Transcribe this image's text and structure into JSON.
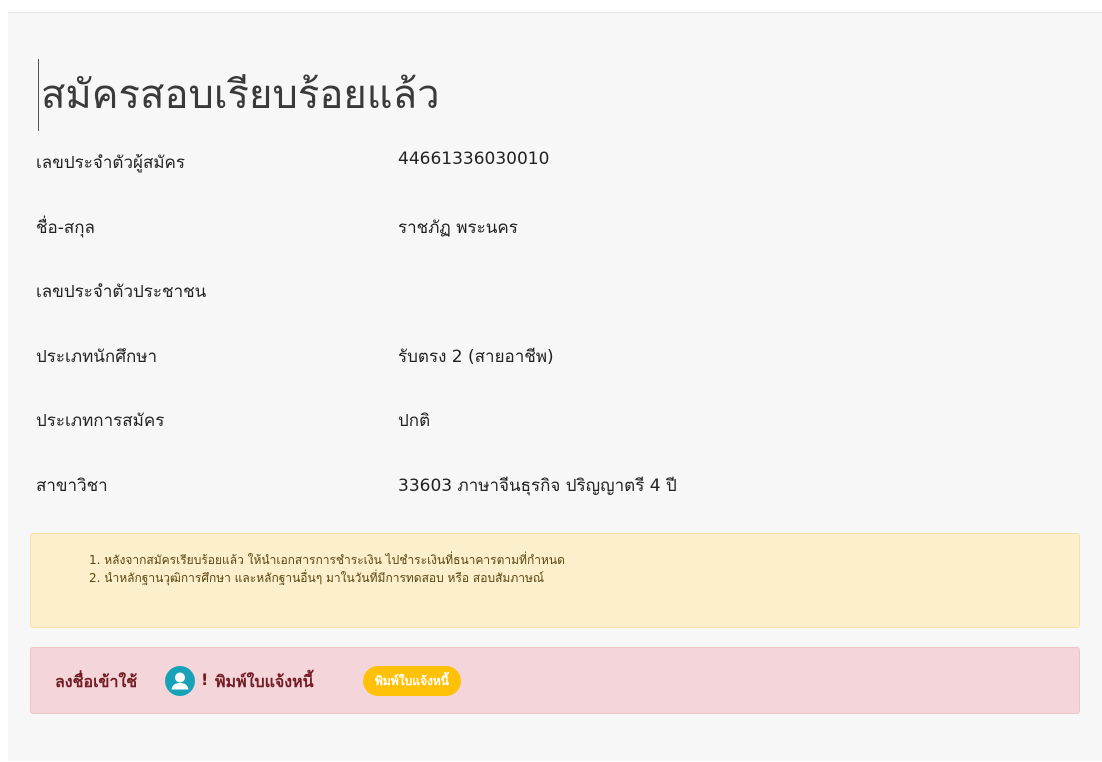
{
  "page": {
    "title": "สมัครสอบเรียบร้อยแล้ว"
  },
  "details": [
    {
      "label": "เลขประจำตัวผู้สมัคร",
      "value": "44661336030010"
    },
    {
      "label": "ชื่อ-สกุล",
      "value": "ราชภัฏ พระนคร"
    },
    {
      "label": "เลขประจำตัวประชาชน",
      "value": ""
    },
    {
      "label": "ประเภทนักศึกษา",
      "value": "รับตรง 2 (สายอาชีพ)"
    },
    {
      "label": "ประเภทการสมัคร",
      "value": "ปกติ"
    },
    {
      "label": "สาขาวิชา",
      "value": "33603 ภาษาจีนธุรกิจ ปริญญาตรี 4 ปี"
    }
  ],
  "notice": {
    "items": [
      "1. หลังจากสมัครเรียบร้อยแล้ว ให้นำเอกสารการชำระเงิน ไปชำระเงินที่ธนาคารตามที่กำหนด",
      "2. นำหลักฐานวุฒิการศึกษา และหลักฐานอื่นๆ มาในวันที่มีการทดสอบ หรือ สอบสัมภาษณ์"
    ],
    "background_color": "#fcefcb"
  },
  "alert": {
    "login_text": "ลงชื่อเข้าใช้",
    "user_icon": "user-circle-icon",
    "exclamation": "!",
    "print_text": "พิมพ์ใบแจ้งหนี้",
    "print_button_label": "พิมพ์ใบแจ้งหนี้",
    "background_color": "#f4d5da",
    "button_color": "#ffc107",
    "icon_color": "#17a2b8"
  }
}
